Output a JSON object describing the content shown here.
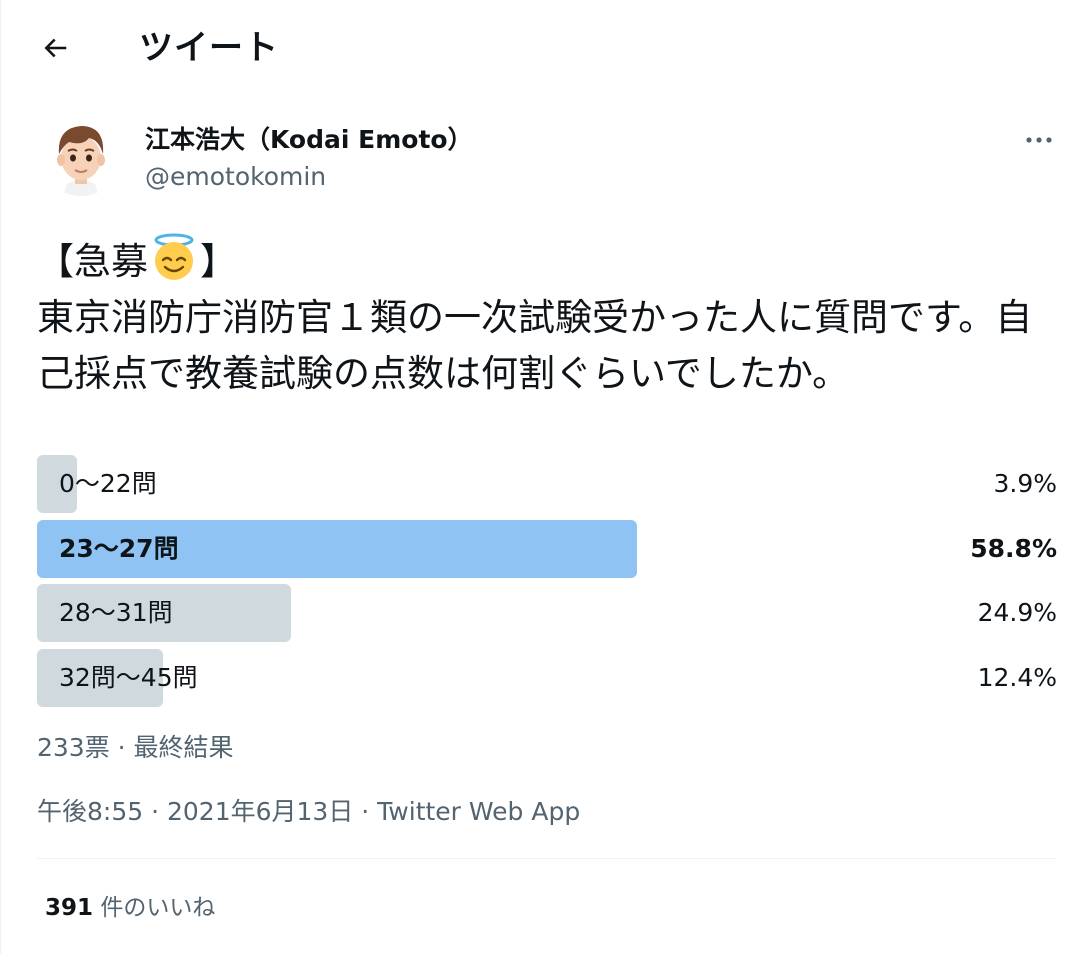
{
  "header": {
    "title": "ツイート",
    "back_icon": "arrow-left-icon"
  },
  "author": {
    "display_name": "江本浩大（Kodai Emoto）",
    "handle": "@emotokomin",
    "avatar_icon": "memoji-avatar",
    "more_icon": "more-horizontal-icon"
  },
  "tweet": {
    "text_part1": "【急募",
    "emoji_icon": "smiling-face-with-halo-emoji",
    "text_part2": "】\n東京消防庁消防官１類の一次試験受かった人に質問です。自己採点で教養試験の点数は何割ぐらいでしたか。"
  },
  "poll": {
    "options": [
      {
        "label": "0〜22問",
        "percent_text": "3.9%",
        "percent": 3.9,
        "winner": false
      },
      {
        "label": "23〜27問",
        "percent_text": "58.8%",
        "percent": 58.8,
        "winner": true
      },
      {
        "label": "28〜31問",
        "percent_text": "24.9%",
        "percent": 24.9,
        "winner": false
      },
      {
        "label": "32問〜45問",
        "percent_text": "12.4%",
        "percent": 12.4,
        "winner": false
      }
    ],
    "meta": "233票 · 最終結果"
  },
  "timestamp": {
    "time_date": "午後8:55 · 2021年6月13日",
    "separator": " · ",
    "source": "Twitter Web App"
  },
  "stats": {
    "likes_count": "391",
    "likes_label": " 件のいいね"
  },
  "colors": {
    "text": "#0f1419",
    "secondary_text": "#536471",
    "poll_bar": "#cfd9de",
    "poll_bar_winner": "#8ec3f4",
    "divider": "#eff3f4"
  }
}
